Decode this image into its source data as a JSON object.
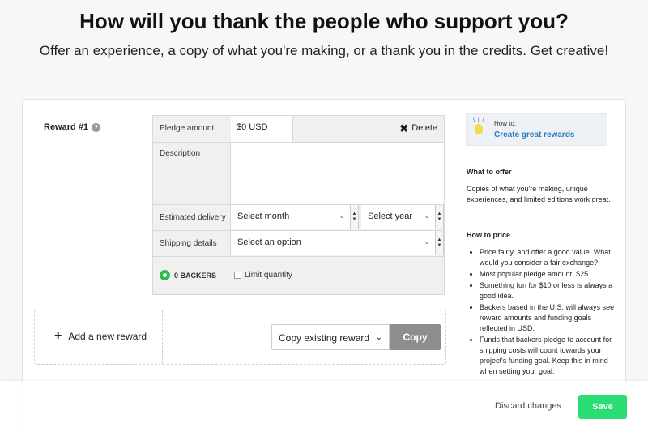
{
  "header": {
    "title": "How will you thank the people who support you?",
    "subtitle": "Offer an experience, a copy of what you're making, or a thank you in the credits. Get creative!"
  },
  "reward": {
    "label": "Reward #1",
    "help_icon": "?",
    "pledge_label": "Pledge amount",
    "pledge_value": "$0 USD",
    "delete_label": "Delete",
    "description_label": "Description",
    "delivery_label": "Estimated delivery",
    "month_select": "Select month",
    "year_select": "Select year",
    "shipping_label": "Shipping details",
    "shipping_select": "Select an option",
    "backers": "0 BACKERS",
    "limit_label": "Limit quantity"
  },
  "add_reward": {
    "label": "Add a new reward",
    "copy_select": "Copy existing reward",
    "copy_button": "Copy"
  },
  "sidebar": {
    "howto_label": "How to:",
    "howto_link": "Create great rewards",
    "what_title": "What to offer",
    "what_text": "Copies of what you're making, unique experiences, and limited editions work great.",
    "price_title": "How to price",
    "tips": [
      "Price fairly, and offer a good value. What would you consider a fair exchange?",
      "Most popular pledge amount: $25",
      "Something fun for $10 or less is always a good idea.",
      "Backers based in the U.S. will always see reward amounts and funding goals reflected in USD.",
      "Funds that backers pledge to account for shipping costs will count towards your project's funding goal. Keep this in mind when setting your goal."
    ]
  },
  "footer": {
    "discard": "Discard changes",
    "save": "Save"
  },
  "colors": {
    "accent": "#2bde73",
    "link": "#2b7bb9",
    "backer_green": "#2bbd4f",
    "copy_button": "#8e8e8e"
  }
}
